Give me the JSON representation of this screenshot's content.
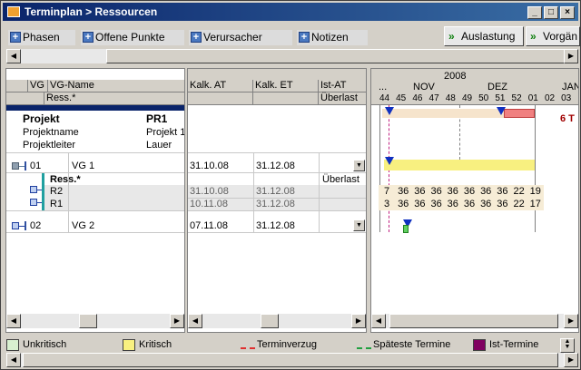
{
  "window": {
    "title": "Terminplan > Ressourcen"
  },
  "tabs": [
    "Phasen",
    "Offene Punkte",
    "Verursacher",
    "Notizen"
  ],
  "buttons": {
    "auslastung": "Auslastung",
    "vorgaenge": "Vorgän"
  },
  "left_headers": {
    "vg": "VG",
    "vgname": "VG-Name",
    "ress": "Ress.*"
  },
  "project": {
    "title_label": "Projekt",
    "title_value": "PR1",
    "name_label": "Projektname",
    "name_value": "Projekt 1",
    "lead_label": "Projektleiter",
    "lead_value": "Lauer"
  },
  "rows": [
    {
      "id": "01",
      "name": "VG 1"
    },
    {
      "label": "Ress.*"
    },
    {
      "name": "R2"
    },
    {
      "name": "R1"
    },
    {
      "id": "02",
      "name": "VG 2"
    }
  ],
  "mid_headers": {
    "kalk_at": "Kalk. AT",
    "kalk_et": "Kalk. ET",
    "ist_at": "Ist-AT",
    "ueberlast": "Überlast"
  },
  "mid_rows": [
    {
      "at": "31.10.08",
      "et": "31.12.08"
    },
    {
      "ist": "Überlast"
    },
    {
      "at": "31.10.08",
      "et": "31.12.08"
    },
    {
      "at": "10.11.08",
      "et": "31.12.08"
    },
    {
      "at": "07.11.08",
      "et": "31.12.08"
    }
  ],
  "gantt": {
    "year": "2008",
    "months": [
      "...",
      "NOV",
      "DEZ",
      "JAN"
    ],
    "weeks": [
      "44",
      "45",
      "46",
      "47",
      "48",
      "49",
      "50",
      "51",
      "52",
      "01",
      "02",
      "03"
    ],
    "project_label": "6 T",
    "r2_values": [
      "7",
      "36",
      "36",
      "36",
      "36",
      "36",
      "36",
      "36",
      "22",
      "19"
    ],
    "r1_values": [
      "3",
      "36",
      "36",
      "36",
      "36",
      "36",
      "36",
      "36",
      "22",
      "17"
    ]
  },
  "legend": [
    "Unkritisch",
    "Kritisch",
    "Terminverzug",
    "Späteste Termine",
    "Ist-Termine"
  ],
  "colors": {
    "title_bar": "#0a246a",
    "kritisch": "#f8f080",
    "unkritisch": "#d8f0d0",
    "ist": "#800060",
    "verzug": "#e03030",
    "bar_red": "#f08080"
  }
}
